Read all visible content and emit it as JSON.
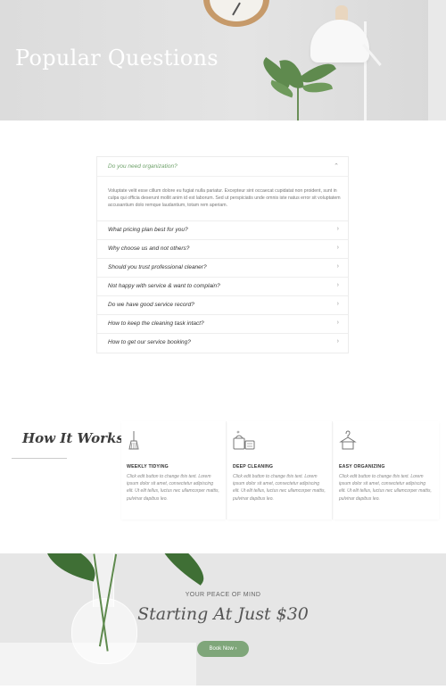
{
  "hero": {
    "title": "Popular Questions"
  },
  "faq": {
    "open_question": "Do you need organization?",
    "open_answer": "Voluptate velit esse cillum dolore eu fugiat nulla pariatur. Excepteur sint occaecat cupidatat non proident, sunt in culpa qui officia deserunt mollit anim id est laborum. Sed ut perspiciatis unde omnis iste natus error sit voluptatem accusantium dolo remque laudantium, totam rem aperiam.",
    "questions": [
      "What pricing plan best for you?",
      "Why choose us and not others?",
      "Should you trust professional cleaner?",
      "Not happy with service & want to complain?",
      "Do we have good service record?",
      "How to keep the cleaning task intact?",
      "How to get our service booking?"
    ],
    "chevron_open": "⌃",
    "chevron_closed": "›"
  },
  "how_it_works": {
    "title": "How It Works",
    "cards": [
      {
        "icon": "broom-icon",
        "title": "WEEKLY TIDYING",
        "text": "Click edit button to change this text. Lorem ipsum dolor sit amet, consectetur adipiscing elit. Ut elit tellus, luctus nec ullamcorper mattis, pulvinar dapibus leo."
      },
      {
        "icon": "cleaning-supplies-icon",
        "title": "DEEP CLEANING",
        "text": "Click edit button to change this text. Lorem ipsum dolor sit amet, consectetur adipiscing elit. Ut elit tellus, luctus nec ullamcorper mattis, pulvinar dapibus leo."
      },
      {
        "icon": "hanger-icon",
        "title": "EASY ORGANIZING",
        "text": "Click edit button to change this text. Lorem ipsum dolor sit amet, consectetur adipiscing elit. Ut elit tellus, luctus nec ullamcorper mattis, pulvinar dapibus leo."
      }
    ]
  },
  "banner": {
    "kicker": "YOUR PEACE OF MIND",
    "price_title": "Starting At Just $30",
    "button_label": "Book Now  ›",
    "accent_color": "#7fa67a"
  }
}
